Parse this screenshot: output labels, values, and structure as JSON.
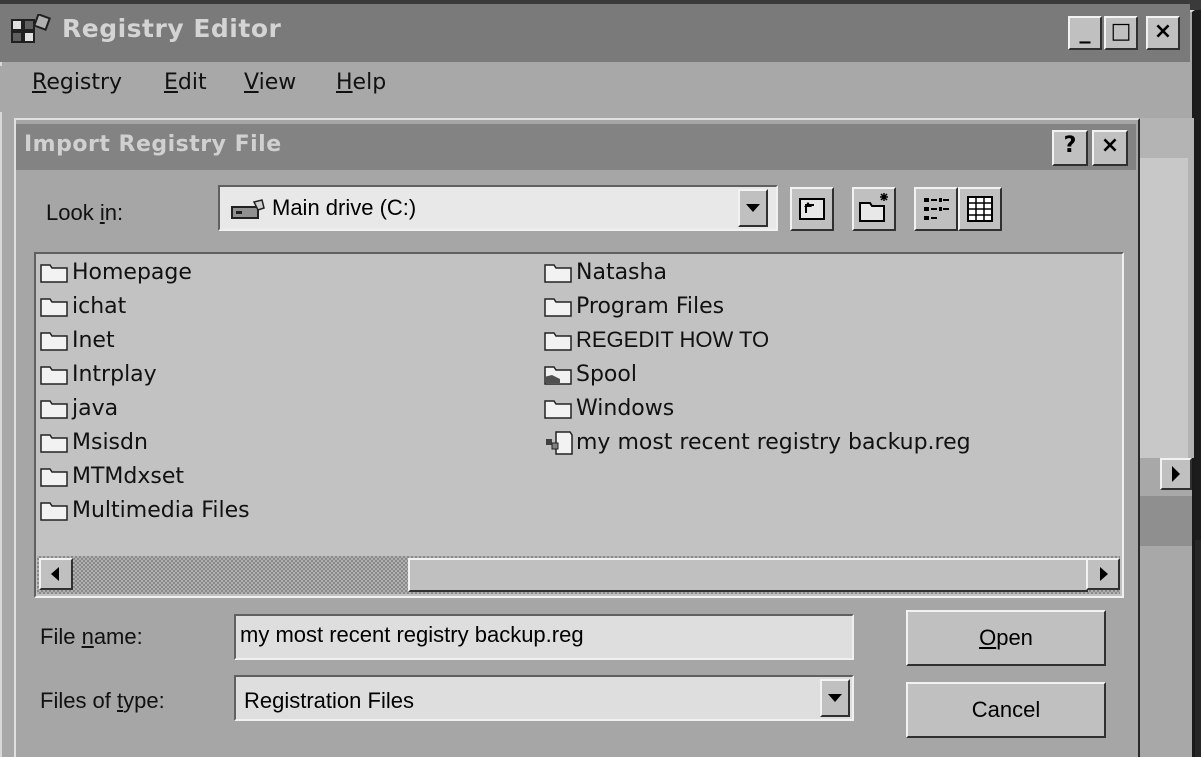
{
  "window": {
    "title": "Registry Editor",
    "controls": {
      "minimize": "_",
      "maximize": "□",
      "close": "×"
    }
  },
  "menu": [
    {
      "label": "Registry",
      "key": "R",
      "rest": "egistry"
    },
    {
      "label": "Edit",
      "key": "E",
      "rest": "dit"
    },
    {
      "label": "View",
      "key": "V",
      "rest": "iew"
    },
    {
      "label": "Help",
      "key": "H",
      "rest": "elp"
    }
  ],
  "dialog": {
    "title": "Import Registry File",
    "help_button": "?",
    "close_button": "×",
    "look_in": {
      "label_before": "Look ",
      "label_key": "i",
      "label_after": "n:",
      "value": "Main drive (C:)",
      "icon": "drive-icon"
    },
    "toolbar_icons": [
      "up-one-level-icon",
      "new-folder-icon",
      "list-view-icon",
      "details-view-icon"
    ],
    "files": [
      {
        "name": "Homepage",
        "type": "folder"
      },
      {
        "name": "ichat",
        "type": "folder"
      },
      {
        "name": "Inet",
        "type": "folder"
      },
      {
        "name": "Intrplay",
        "type": "folder"
      },
      {
        "name": "java",
        "type": "folder"
      },
      {
        "name": "Msisdn",
        "type": "folder"
      },
      {
        "name": "MTMdxset",
        "type": "folder"
      },
      {
        "name": "Multimedia Files",
        "type": "folder"
      },
      {
        "name": "Natasha",
        "type": "folder"
      },
      {
        "name": "Program Files",
        "type": "folder"
      },
      {
        "name": "REGEDIT HOW TO",
        "type": "folder"
      },
      {
        "name": "Spool",
        "type": "shared-folder"
      },
      {
        "name": "Windows",
        "type": "folder"
      },
      {
        "name": "my most recent registry backup.reg",
        "type": "reg-file"
      }
    ],
    "file_name": {
      "label_before": "File ",
      "label_key": "n",
      "label_after": "ame:",
      "value": "my most recent registry backup.reg"
    },
    "file_type": {
      "label_before": "Files of ",
      "label_key": "t",
      "label_after": "ype:",
      "value": "Registration Files"
    },
    "buttons": {
      "open_key": "O",
      "open_rest": "pen",
      "cancel": "Cancel"
    }
  }
}
